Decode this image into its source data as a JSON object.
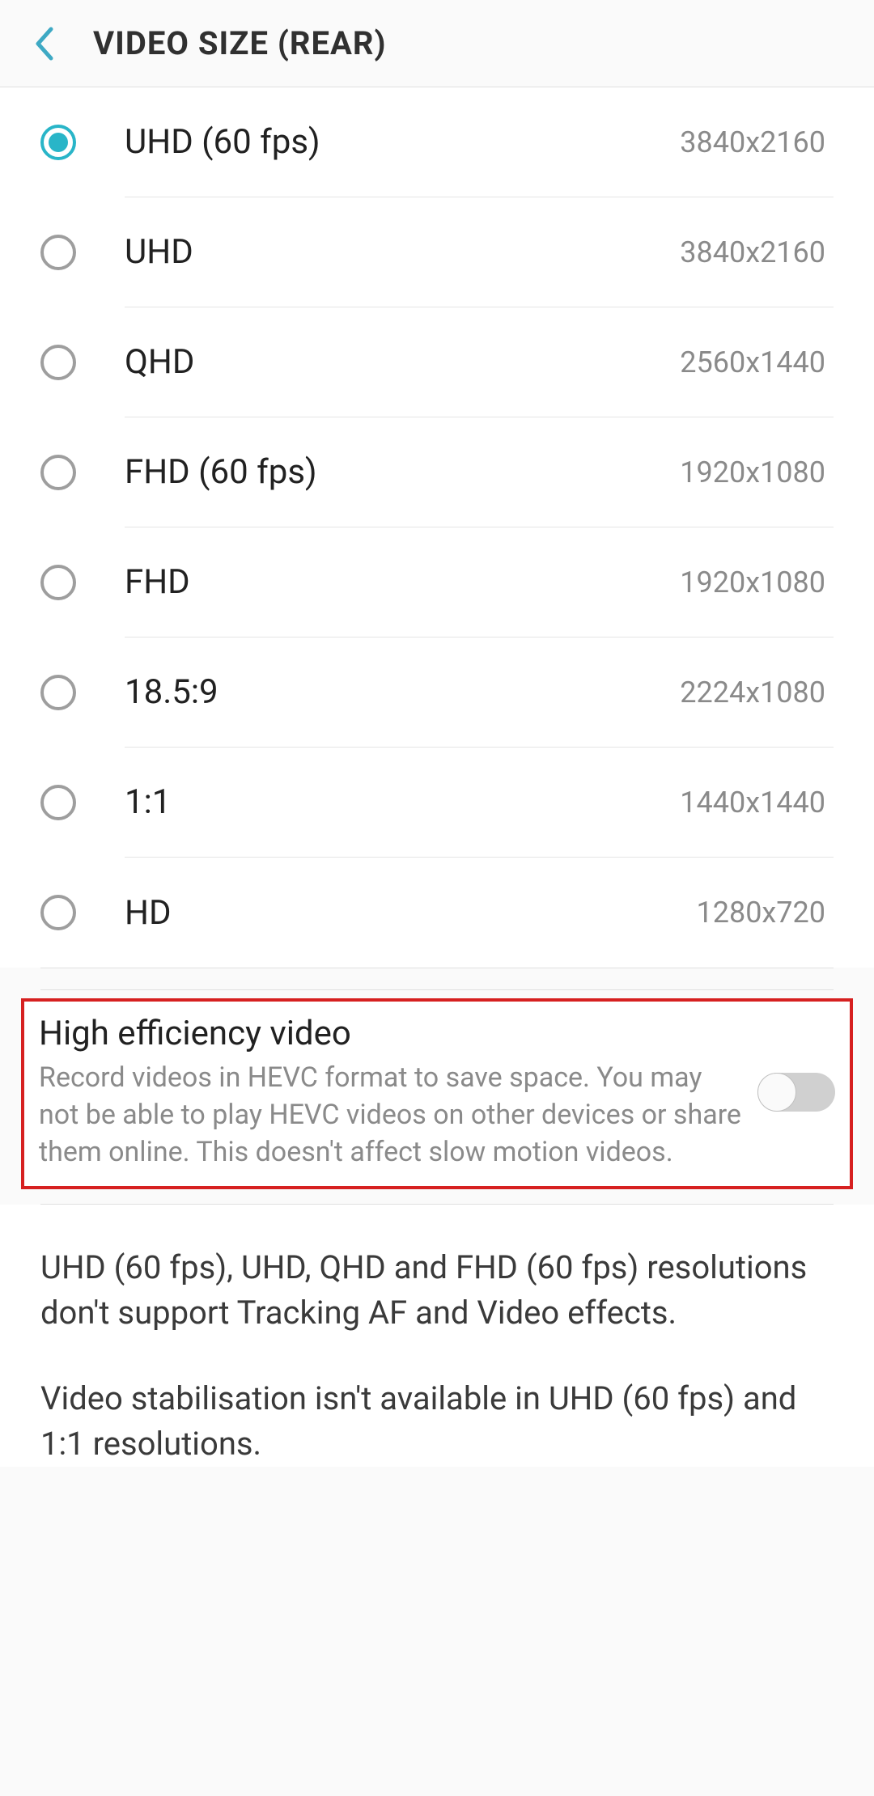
{
  "header": {
    "title": "VIDEO SIZE (REAR)"
  },
  "options": [
    {
      "label": "UHD (60 fps)",
      "resolution": "3840x2160",
      "selected": true
    },
    {
      "label": "UHD",
      "resolution": "3840x2160",
      "selected": false
    },
    {
      "label": "QHD",
      "resolution": "2560x1440",
      "selected": false
    },
    {
      "label": "FHD (60 fps)",
      "resolution": "1920x1080",
      "selected": false
    },
    {
      "label": "FHD",
      "resolution": "1920x1080",
      "selected": false
    },
    {
      "label": "18.5:9",
      "resolution": "2224x1080",
      "selected": false
    },
    {
      "label": "1:1",
      "resolution": "1440x1440",
      "selected": false
    },
    {
      "label": "HD",
      "resolution": "1280x720",
      "selected": false
    }
  ],
  "hevc": {
    "title": "High efficiency video",
    "description": "Record videos in HEVC format to save space. You may not be able to play HEVC videos on other devices or share them online. This doesn't affect slow motion videos.",
    "enabled": false
  },
  "info": {
    "paragraph1": "UHD (60 fps), UHD, QHD and FHD (60 fps) resolutions don't support Tracking AF and Video effects.",
    "paragraph2": "Video stabilisation isn't available in UHD (60 fps) and 1:1 resolutions."
  }
}
